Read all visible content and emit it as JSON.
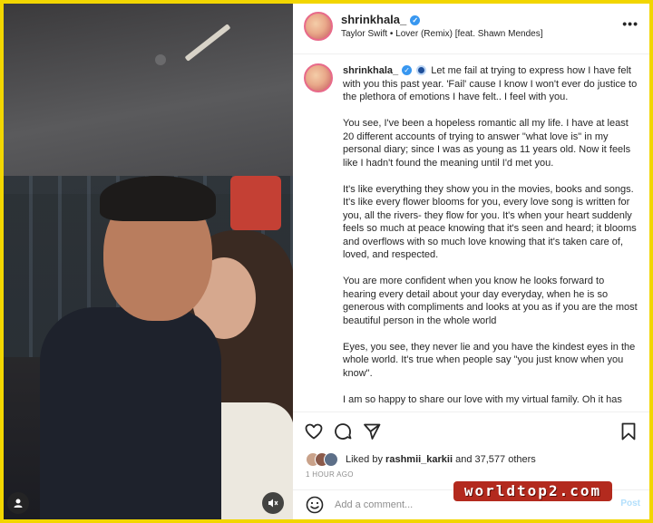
{
  "header": {
    "username": "shrinkhala_",
    "song": "Taylor Swift • Lover (Remix) [feat. Shawn Mendes]",
    "more_icon": "more-horizontal-icon"
  },
  "caption": {
    "username": "shrinkhala_",
    "intro": "Let me fail at trying to express how I have felt with you this past year. 'Fail' cause I know I won't ever do justice to the plethora of emotions I have felt.. I feel with you.",
    "paragraphs": [
      "You see, I've been a hopeless romantic all my life. I have at least 20 different accounts of trying to answer \"what love is\" in my personal diary; since I was as young as 11 years old. Now it feels like I hadn't found the meaning until I'd met you.",
      "It's like everything they show you in the movies, books and songs. It's like every flower blooms for you, every love song is written for you, all the rivers- they flow for you. It's when your heart suddenly feels so much at peace knowing that it's seen and heard; it blooms and overflows with so much love knowing that it's taken care of, loved, and respected.",
      "You are more confident when you know he looks forward to hearing every detail about your day everyday, when he is so generous with compliments and looks at you as if you are the most beautiful person in the whole world",
      "Eyes, you see, they never lie and you have the kindest eyes in the whole world. It's true when people say \"you just know when you know\".",
      "I am so happy to share our love with my virtual family. Oh it has"
    ]
  },
  "likes": {
    "prefix": "Liked by",
    "user": "rashmii_karkii",
    "suffix": "and 37,577 others"
  },
  "time_ago": "1 HOUR AGO",
  "comment_box": {
    "placeholder": "Add a comment...",
    "post_label": "Post"
  },
  "watermark": "worldtop2.com",
  "colors": {
    "frame": "#f2d600",
    "verified": "#3897f0",
    "post_disabled": "#b2dffc",
    "watermark_bg": "#b32a1e"
  }
}
